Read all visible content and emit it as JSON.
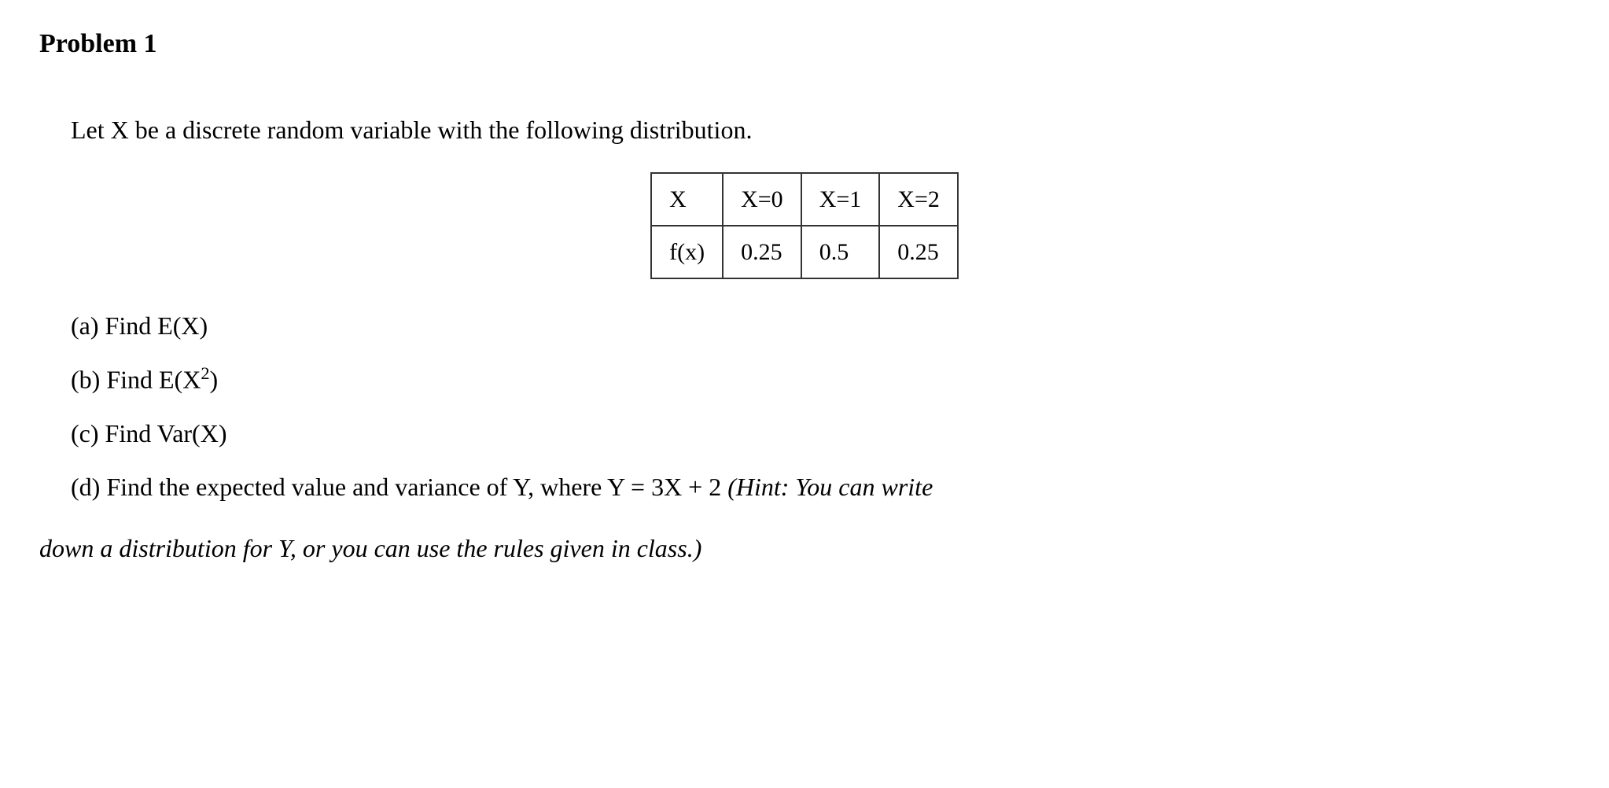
{
  "title": "Problem 1",
  "intro": "Let X be a discrete random variable with the following distribution.",
  "table": {
    "r1c1": "X",
    "r1c2": "X=0",
    "r1c3": "X=1",
    "r1c4": "X=2",
    "r2c1": "f(x)",
    "r2c2": "0.25",
    "r2c3": "0.5",
    "r2c4": "0.25"
  },
  "parts": {
    "a": "(a) Find E(X)",
    "b_prefix": "(b) Find E(X",
    "b_sup": "2",
    "b_suffix": ")",
    "c": "(c) Find Var(X)",
    "d_main": "(d) Find the expected value and variance of Y, where Y = 3X + 2 ",
    "d_hint": "(Hint: You can write",
    "d_cont": "down a distribution for Y, or you can use the rules given in class.)"
  }
}
